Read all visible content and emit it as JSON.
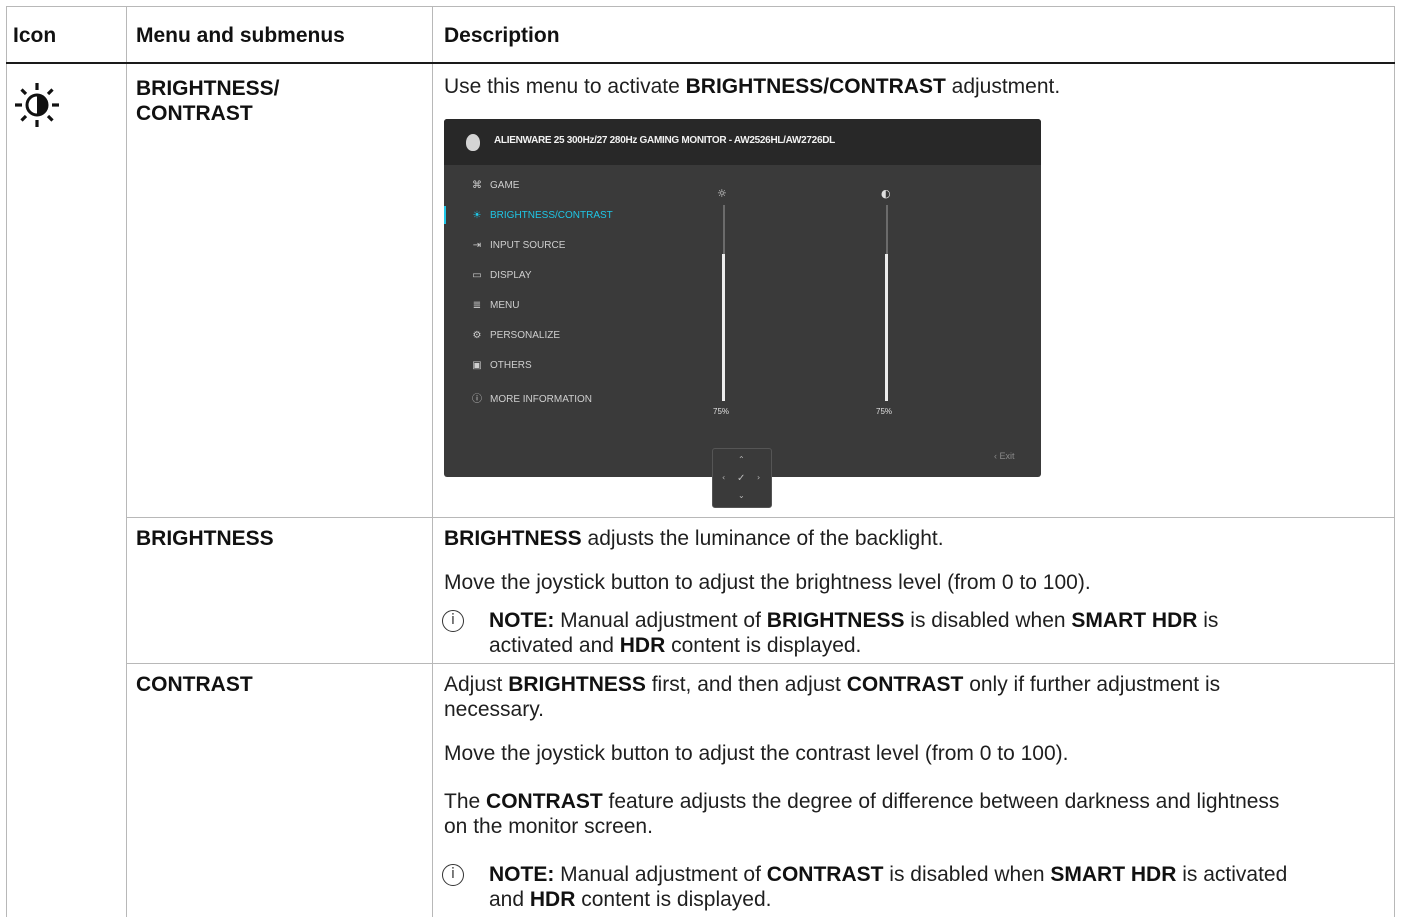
{
  "table": {
    "headers": {
      "icon": "Icon",
      "menu": "Menu and submenus",
      "description": "Description"
    }
  },
  "rows": {
    "brightness_contrast": {
      "icon": "brightness-contrast-icon",
      "menu_line1": "BRIGHTNESS/",
      "menu_line2": "CONTRAST",
      "desc_pre": "Use this menu to activate ",
      "desc_bold": "BRIGHTNESS/CONTRAST",
      "desc_post": " adjustment."
    },
    "brightness": {
      "menu": "BRIGHTNESS",
      "p1_bold": "BRIGHTNESS",
      "p1_rest": " adjusts the luminance of the backlight.",
      "p2": "Move the joystick button to adjust the brightness level (from 0 to 100).",
      "note_label": "NOTE:",
      "note_a": " Manual adjustment of ",
      "note_b": "BRIGHTNESS",
      "note_c": " is disabled when ",
      "note_d": "SMART HDR",
      "note_e": " is",
      "note_line2a": "activated and ",
      "note_line2b": "HDR",
      "note_line2c": " content is displayed."
    },
    "contrast": {
      "menu": "CONTRAST",
      "p1a": "Adjust ",
      "p1b": "BRIGHTNESS",
      "p1c": " first, and then adjust ",
      "p1d": "CONTRAST",
      "p1e": " only if further adjustment is",
      "p1_line2": "necessary.",
      "p2": "Move the joystick button to adjust the contrast level (from 0 to 100).",
      "p3a": "The ",
      "p3b": "CONTRAST",
      "p3c": " feature adjusts the degree of difference between darkness and lightness",
      "p3_line2": "on the monitor screen.",
      "note_label": "NOTE:",
      "note_a": " Manual adjustment of ",
      "note_b": "CONTRAST",
      "note_c": " is disabled when ",
      "note_d": "SMART HDR",
      "note_e": " is activated",
      "note_line2a": "and ",
      "note_line2b": "HDR",
      "note_line2c": " content is displayed."
    }
  },
  "osd": {
    "title": "ALIENWARE 25 300Hz/27 280Hz GAMING MONITOR - AW2526HL/AW2726DL",
    "menu_items": [
      {
        "label": "GAME",
        "icon": "gamepad-icon"
      },
      {
        "label": "BRIGHTNESS/CONTRAST",
        "icon": "sun-icon"
      },
      {
        "label": "INPUT SOURCE",
        "icon": "input-icon"
      },
      {
        "label": "DISPLAY",
        "icon": "monitor-icon"
      },
      {
        "label": "MENU",
        "icon": "menu-icon"
      },
      {
        "label": "PERSONALIZE",
        "icon": "gear-icon"
      },
      {
        "label": "OTHERS",
        "icon": "others-icon"
      },
      {
        "label": "MORE INFORMATION",
        "icon": "info-icon"
      }
    ],
    "brightness_value": "75%",
    "contrast_value": "75%",
    "brightness_level": 0.75,
    "contrast_level": 0.75,
    "exit_label": "Exit",
    "active_color": "#1fc6e6"
  }
}
